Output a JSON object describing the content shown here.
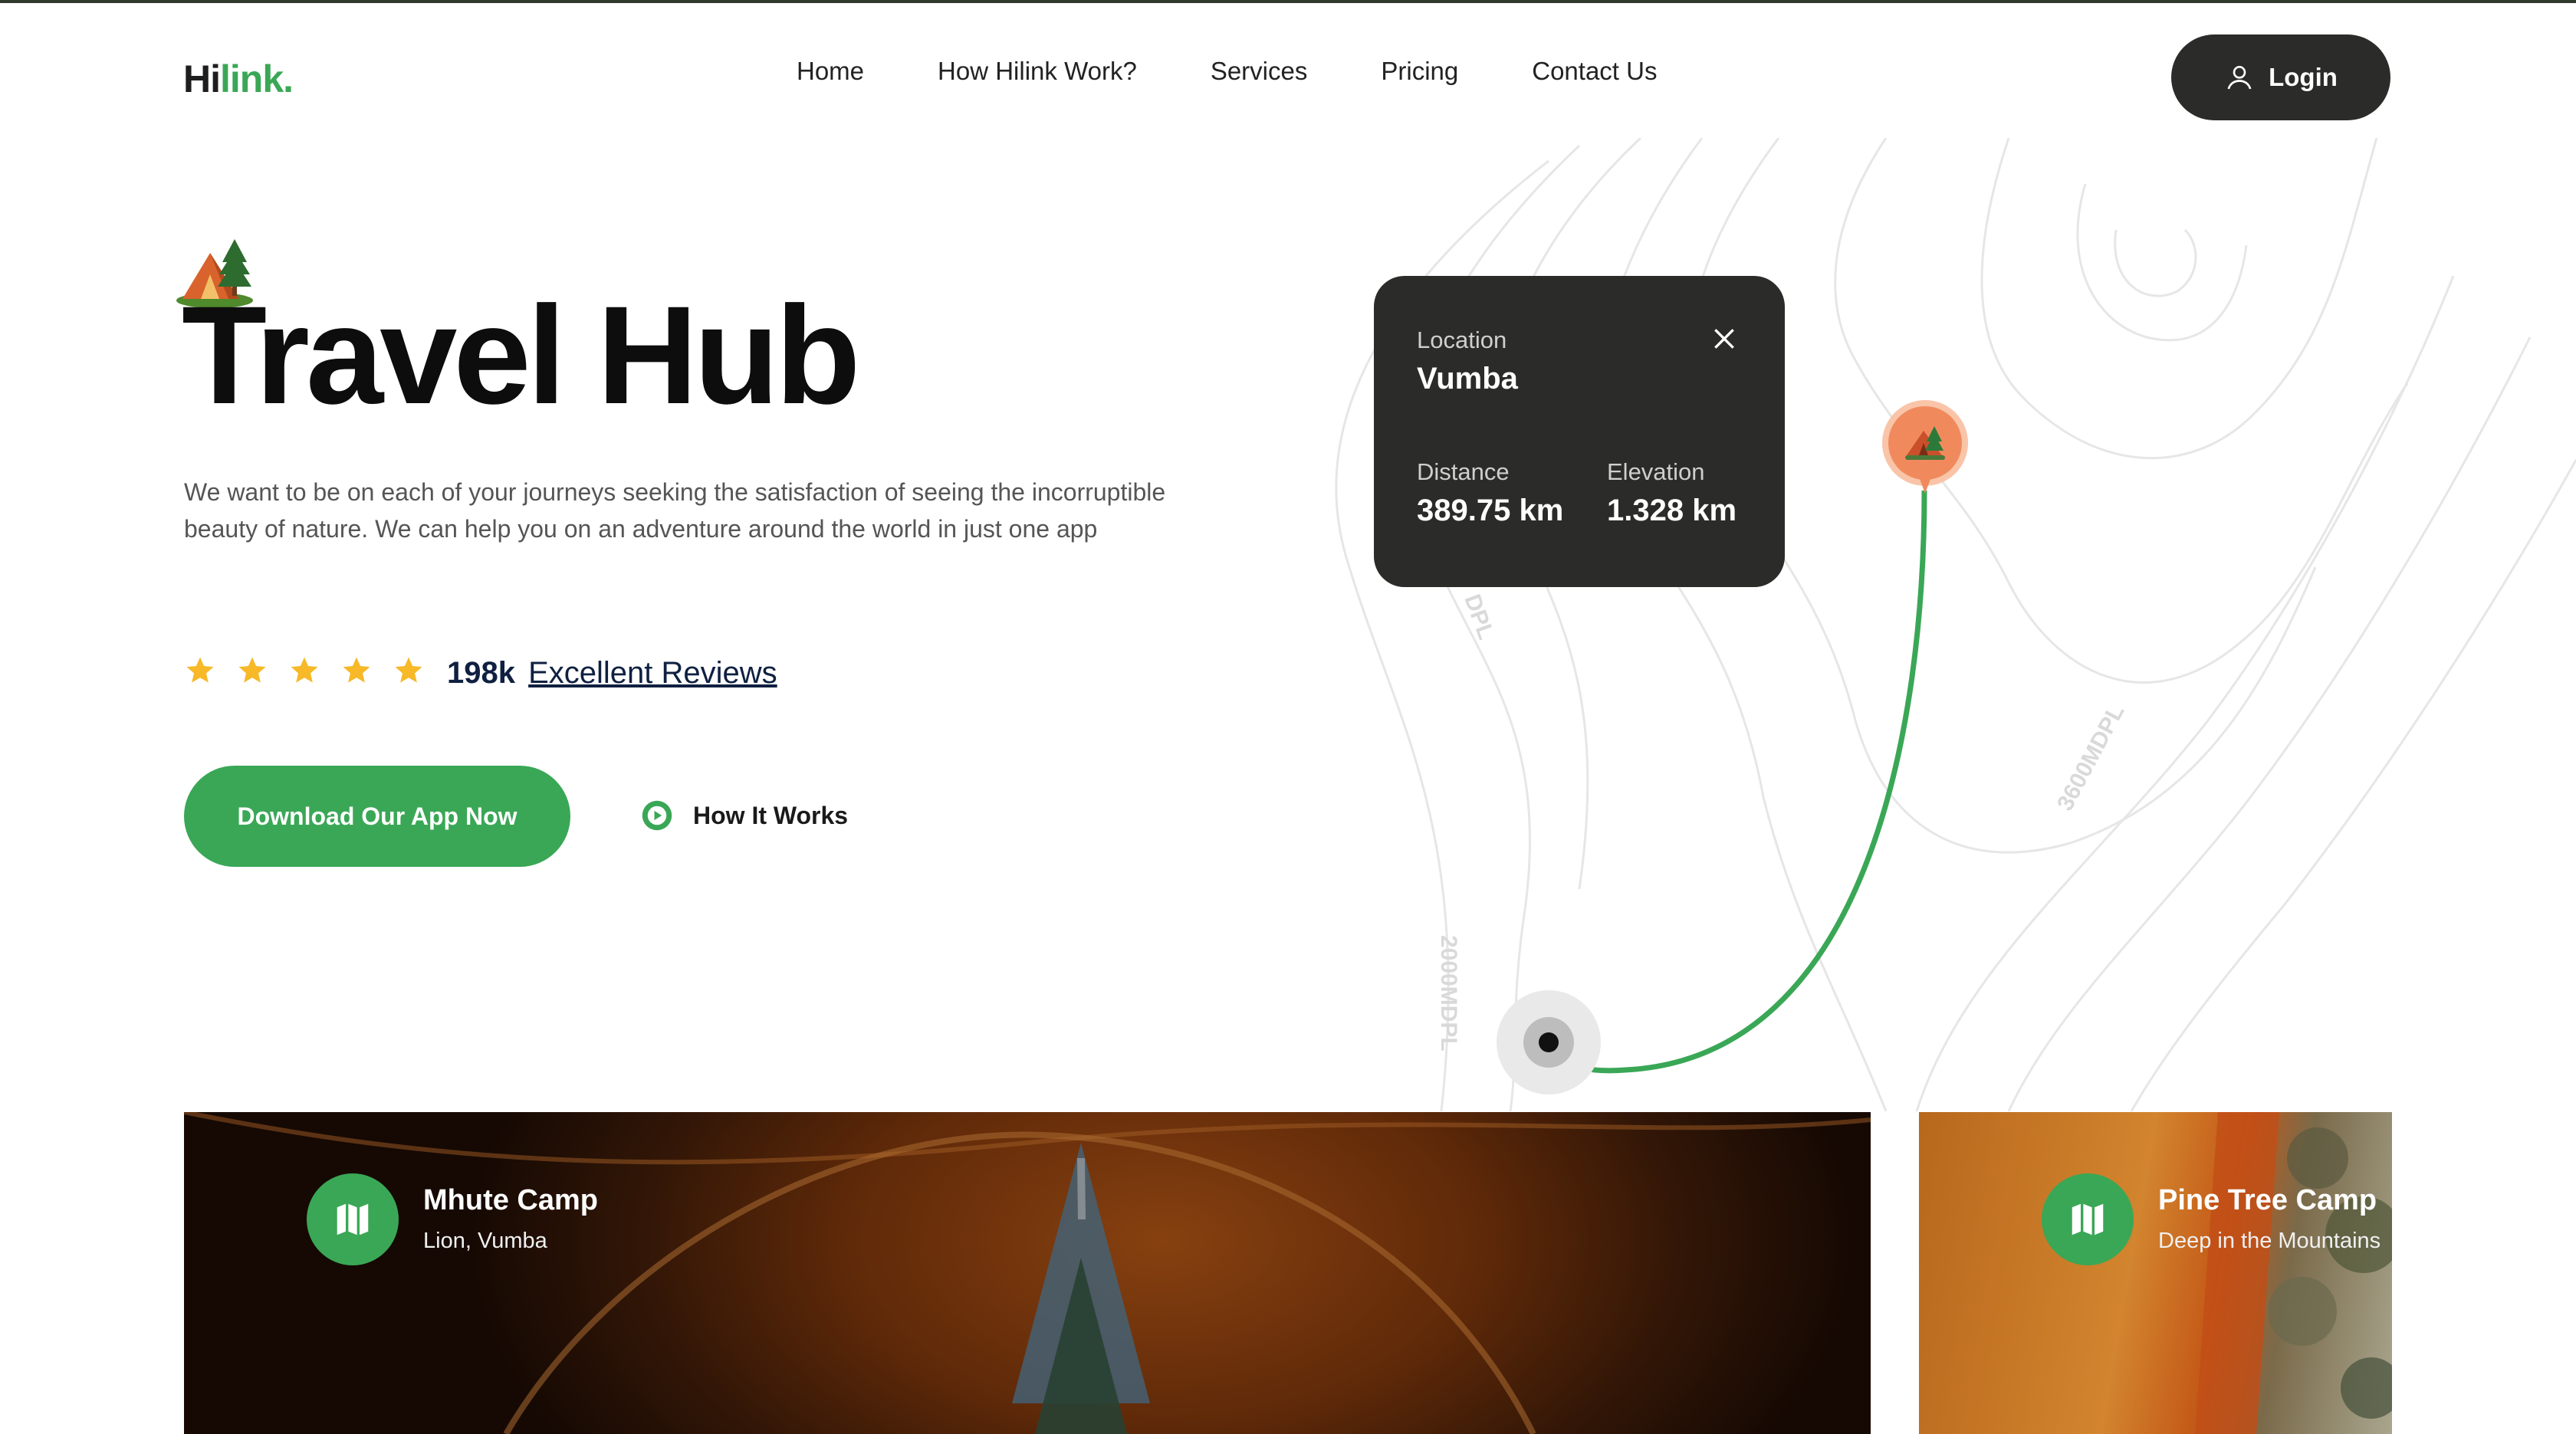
{
  "brand": {
    "name_main": "Hi",
    "name_accent": "link."
  },
  "nav": {
    "items": [
      {
        "label": "Home"
      },
      {
        "label": "How Hilink Work?"
      },
      {
        "label": "Services"
      },
      {
        "label": "Pricing"
      },
      {
        "label": "Contact Us"
      }
    ],
    "login_label": "Login"
  },
  "hero": {
    "title": "Travel Hub",
    "description": "We want to be on each of your journeys seeking the satisfaction of seeing the incorruptible beauty of nature. We can help you on an adventure around the world in just one app",
    "rating": {
      "stars": 5,
      "count": "198k",
      "link_text": "Excellent Reviews"
    },
    "download_label": "Download Our App Now",
    "how_it_works_label": "How It Works"
  },
  "map": {
    "contour_labels": [
      "2000MDPL",
      "3600MDPL",
      "DPL"
    ]
  },
  "location_card": {
    "location_label": "Location",
    "location_value": "Vumba",
    "distance_label": "Distance",
    "distance_value": "389.75 km",
    "elevation_label": "Elevation",
    "elevation_value": "1.328 km"
  },
  "camps": [
    {
      "title": "Mhute Camp",
      "subtitle": "Lion, Vumba"
    },
    {
      "title": "Pine Tree Camp",
      "subtitle": "Deep in the Mountains"
    }
  ],
  "colors": {
    "accent": "#3aa756",
    "dark": "#2b2c29",
    "star": "#f7b928",
    "pin": "#f08a5d"
  }
}
